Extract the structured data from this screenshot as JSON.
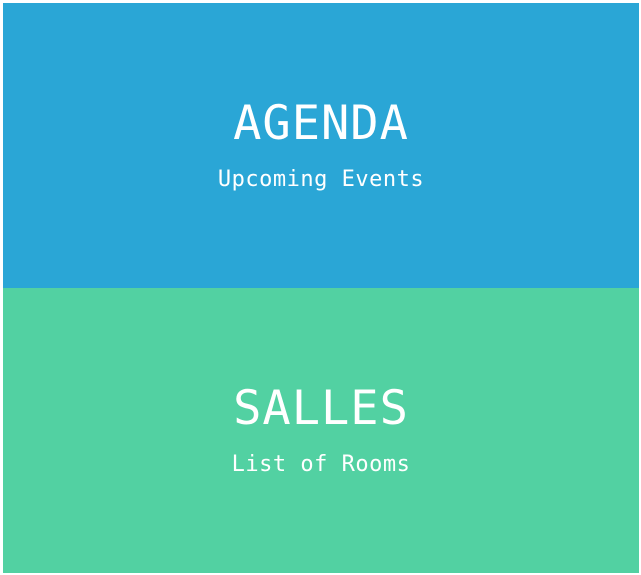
{
  "tiles": {
    "agenda": {
      "title": "AGENDA",
      "subtitle": "Upcoming Events",
      "color": "#2aa6d6"
    },
    "salles": {
      "title": "SALLES",
      "subtitle": "List of Rooms",
      "color": "#52d1a2"
    }
  }
}
